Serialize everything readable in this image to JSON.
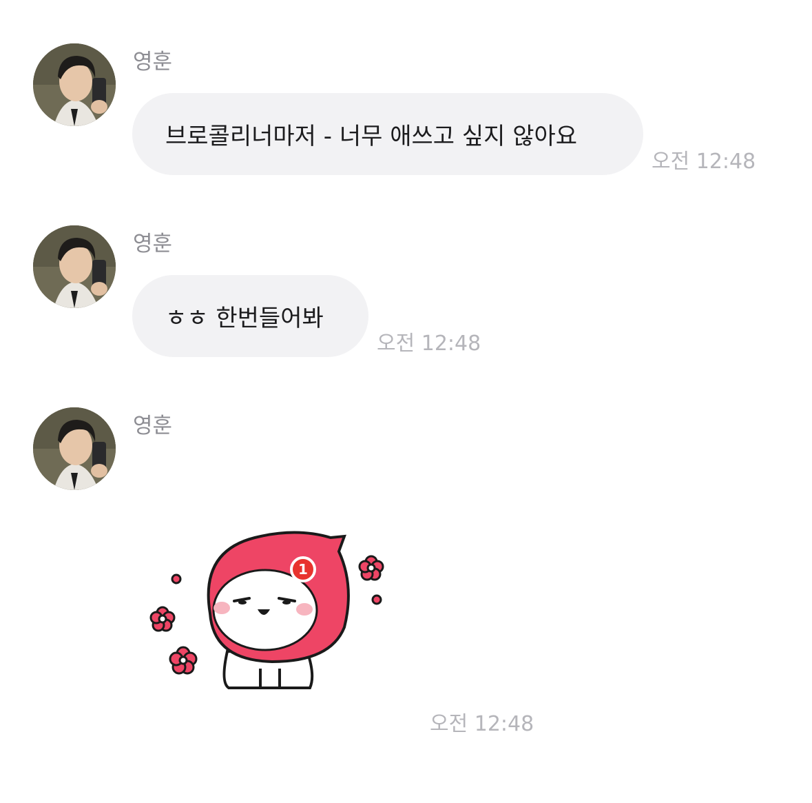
{
  "messages": [
    {
      "sender": "영훈",
      "text": "브로콜리너마저 - 너무 애쓰고 싶지 않아요",
      "time": "오전 12:48"
    },
    {
      "sender": "영훈",
      "text": "ㅎㅎ 한번들어봐",
      "time": "오전 12:48"
    },
    {
      "sender": "영훈",
      "sticker": {
        "description_icon": "pink-hooded-character-sticker",
        "badge": "1"
      },
      "time": "오전 12:48"
    }
  ],
  "colors": {
    "bubble": "#f2f2f4",
    "sender": "#8d8d93",
    "time": "#b5b5ba",
    "sticker_pink": "#ee4565",
    "badge_red": "#e8332e"
  }
}
